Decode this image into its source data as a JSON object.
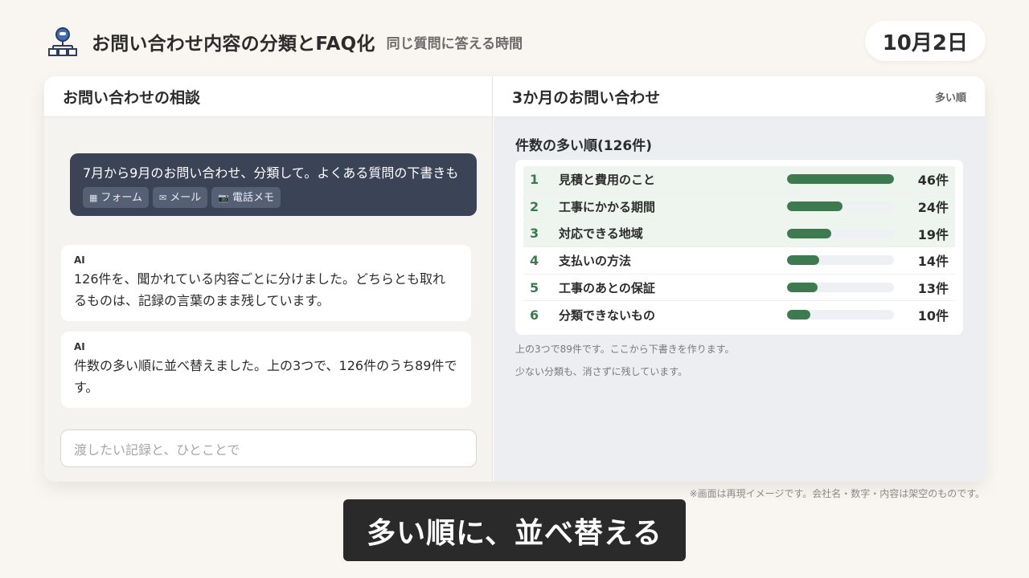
{
  "header": {
    "title": "お問い合わせ内容の分類とFAQ化",
    "subtitle": "同じ質問に答える時間",
    "date": "10月2日",
    "logo_icon": "org-chart-icon"
  },
  "left_panel": {
    "title": "お問い合わせの相談",
    "user_message": "7月から9月のお問い合わせ、分類して。よくある質問の下書きも",
    "attachments": [
      {
        "icon": "grid-icon",
        "glyph": "▦",
        "label": "フォーム"
      },
      {
        "icon": "mail-icon",
        "glyph": "✉",
        "label": "メール"
      },
      {
        "icon": "camera-icon",
        "glyph": "📷",
        "label": "電話メモ"
      }
    ],
    "ai_messages": [
      {
        "label": "AI",
        "text": "126件を、聞かれている内容ごとに分けました。どちらとも取れるものは、記録の言葉のまま残しています。"
      },
      {
        "label": "AI",
        "text": "件数の多い順に並べ替えました。上の3つで、126件のうち89件です。"
      }
    ],
    "input_placeholder": "渡したい記録と、ひとことで"
  },
  "right_panel": {
    "title": "3か月のお問い合わせ",
    "sort_label": "多い順",
    "ranking_title": "件数の多い順(126件)",
    "rows": [
      {
        "rank": "1",
        "label": "見積と費用のこと",
        "count": 46,
        "count_text": "46件"
      },
      {
        "rank": "2",
        "label": "工事にかかる期間",
        "count": 24,
        "count_text": "24件"
      },
      {
        "rank": "3",
        "label": "対応できる地域",
        "count": 19,
        "count_text": "19件"
      },
      {
        "rank": "4",
        "label": "支払いの方法",
        "count": 14,
        "count_text": "14件"
      },
      {
        "rank": "5",
        "label": "工事のあとの保証",
        "count": 13,
        "count_text": "13件"
      },
      {
        "rank": "6",
        "label": "分類できないもの",
        "count": 10,
        "count_text": "10件"
      }
    ],
    "max_count": 46,
    "notes": [
      "上の3つで89件です。ここから下書きを作ります。",
      "少ない分類も、消さずに残しています。"
    ]
  },
  "footer": {
    "disclaimer": "※画面は再現イメージです。会社名・数字・内容は架空のものです。",
    "caption": "多い順に、並べ替える"
  },
  "colors": {
    "accent_green": "#3d7a4f",
    "user_bubble": "#3b4457",
    "caption_bg": "#2a2a2a"
  }
}
